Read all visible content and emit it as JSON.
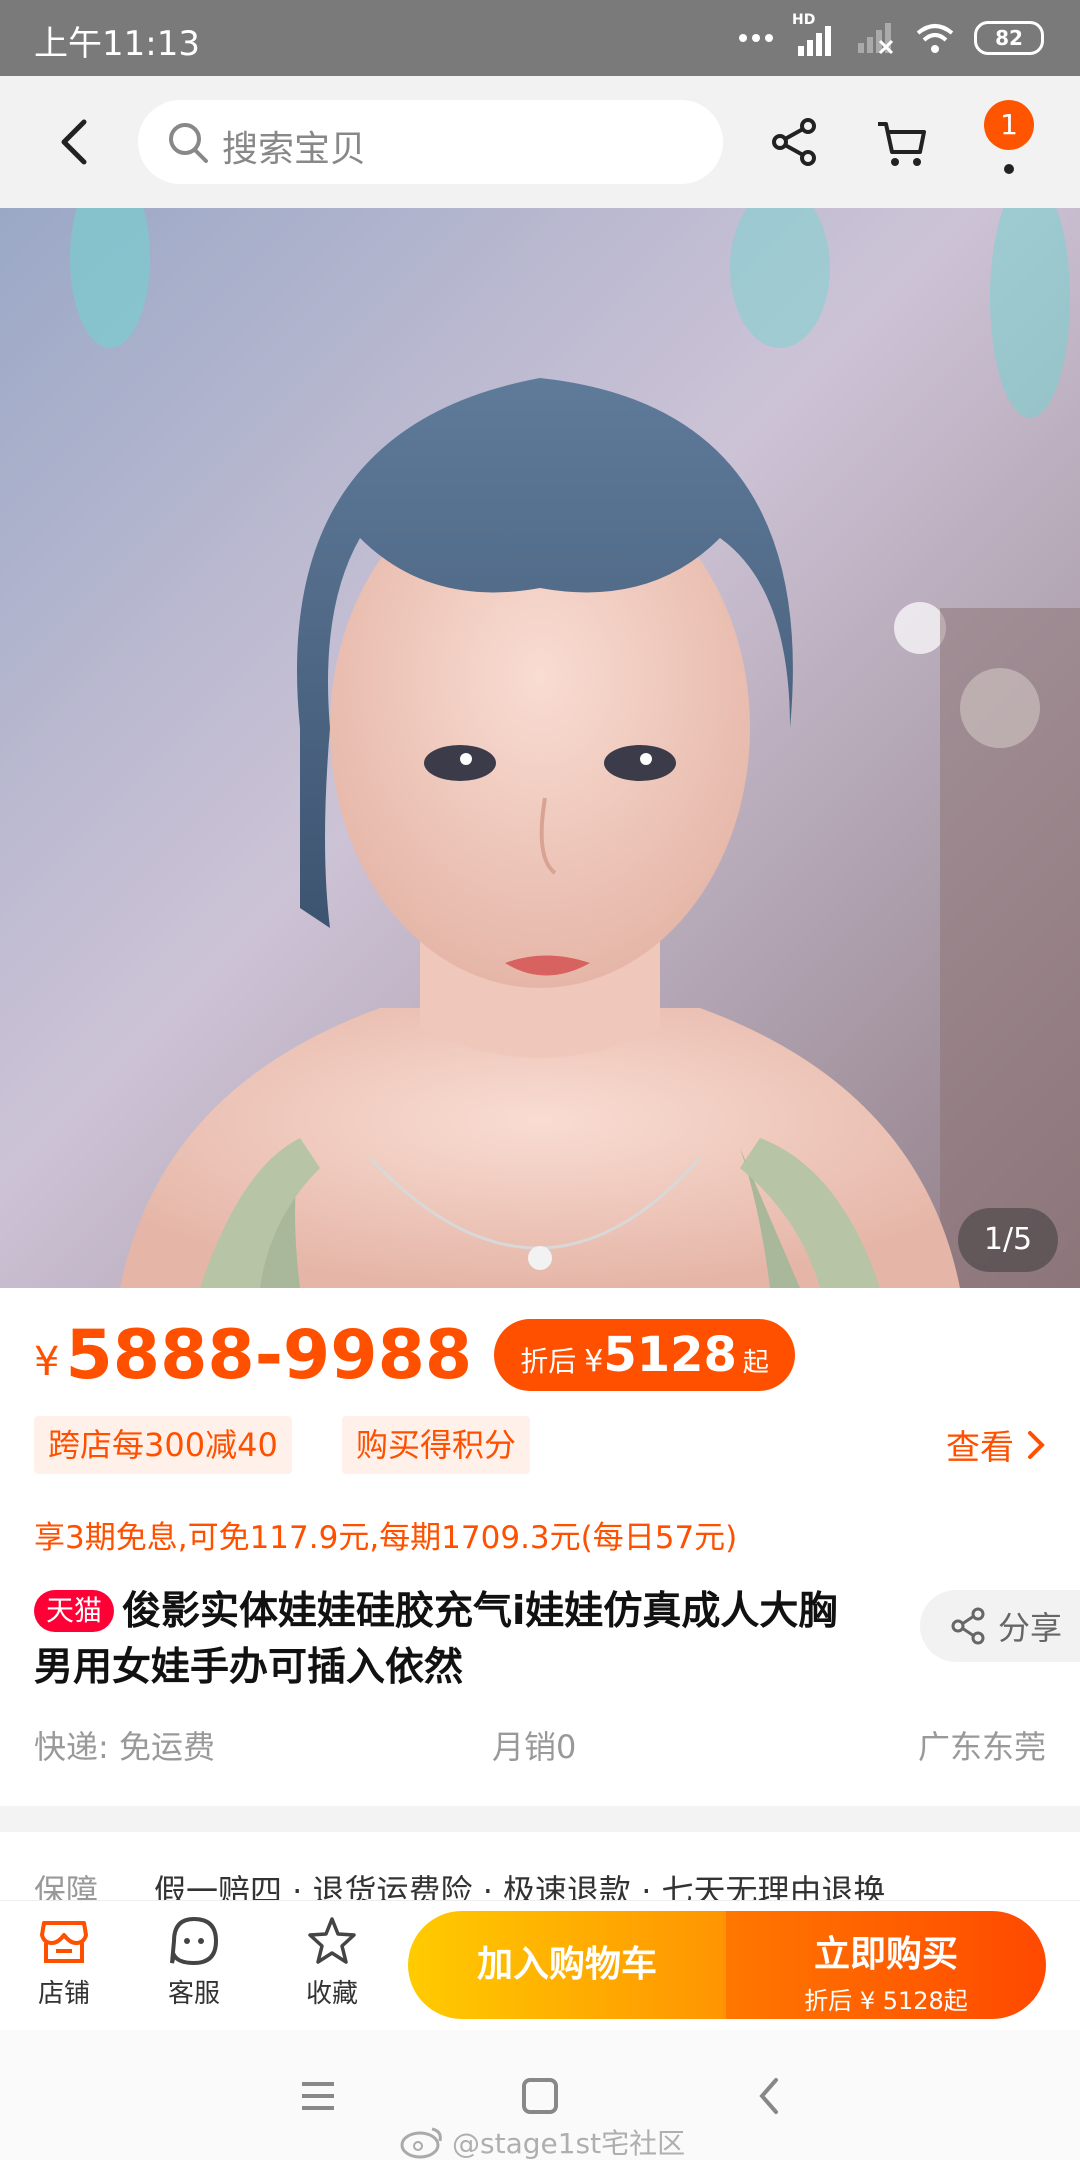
{
  "status_bar": {
    "time": "上午11:13",
    "network_badge": "HD",
    "battery": "82"
  },
  "header": {
    "search_placeholder": "搜索宝贝",
    "cart_badge": "1"
  },
  "gallery": {
    "counter": "1/5"
  },
  "price": {
    "symbol": "¥",
    "range": "5888-9988",
    "discount_label": "折后",
    "discount_symbol": "¥",
    "discount_value": "5128",
    "discount_suffix": "起"
  },
  "promotions": {
    "tags": [
      "跨店每300减40",
      "购买得积分"
    ],
    "view_label": "查看"
  },
  "installment_text": "享3期免息,可免117.9元,每期1709.3元(每日57元)",
  "product": {
    "badge": "天猫",
    "title": "俊影实体娃娃硅胶充气i娃娃仿真成人大胸男用女娃手办可插入依然",
    "share_label": "分享"
  },
  "meta": {
    "shipping": "快递: 免运费",
    "monthly_sales": "月销0",
    "location": "广东东莞"
  },
  "guarantee": {
    "label": "保障",
    "items": "假一赔四 · 退货运费险 · 极速退款 · 七天无理由退换"
  },
  "action_bar": {
    "shop_label": "店铺",
    "service_label": "客服",
    "favorite_label": "收藏",
    "add_cart_label": "加入购物车",
    "buy_now_label": "立即购买",
    "buy_now_sub": "折后 ¥ 5128起"
  },
  "watermark": "@stage1st宅社区",
  "colors": {
    "accent": "#ff5000",
    "tmall": "#ff0036"
  }
}
